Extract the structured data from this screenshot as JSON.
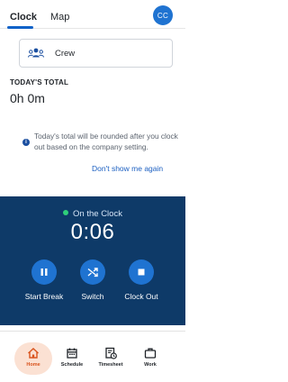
{
  "tabs": [
    {
      "label": "Clock"
    },
    {
      "label": "Map"
    }
  ],
  "user": {
    "initials": "CC"
  },
  "crew": {
    "label": "Crew"
  },
  "today": {
    "label": "TODAY'S TOTAL",
    "value": "0h 0m"
  },
  "notice": {
    "text": "Today's total will be rounded after you clock out based on the company setting.",
    "link": "Don't show me again"
  },
  "clock": {
    "status": "On the Clock",
    "time": "0:06",
    "actions": [
      {
        "label": "Start Break",
        "icon": "pause-icon"
      },
      {
        "label": "Switch",
        "icon": "shuffle-icon"
      },
      {
        "label": "Clock Out",
        "icon": "stop-icon"
      }
    ]
  },
  "nav": [
    {
      "label": "Home",
      "icon": "home-icon",
      "active": true
    },
    {
      "label": "Schedule",
      "icon": "calendar-icon"
    },
    {
      "label": "Timesheet",
      "icon": "timesheet-icon"
    },
    {
      "label": "Work",
      "icon": "briefcase-icon"
    }
  ],
  "colors": {
    "primary": "#1f73d1",
    "panel": "#0e3a68",
    "status_dot": "#2fd07a",
    "active_nav": "#d9541e",
    "active_nav_bg": "#fbe1d3",
    "link": "#1b5fc1"
  }
}
